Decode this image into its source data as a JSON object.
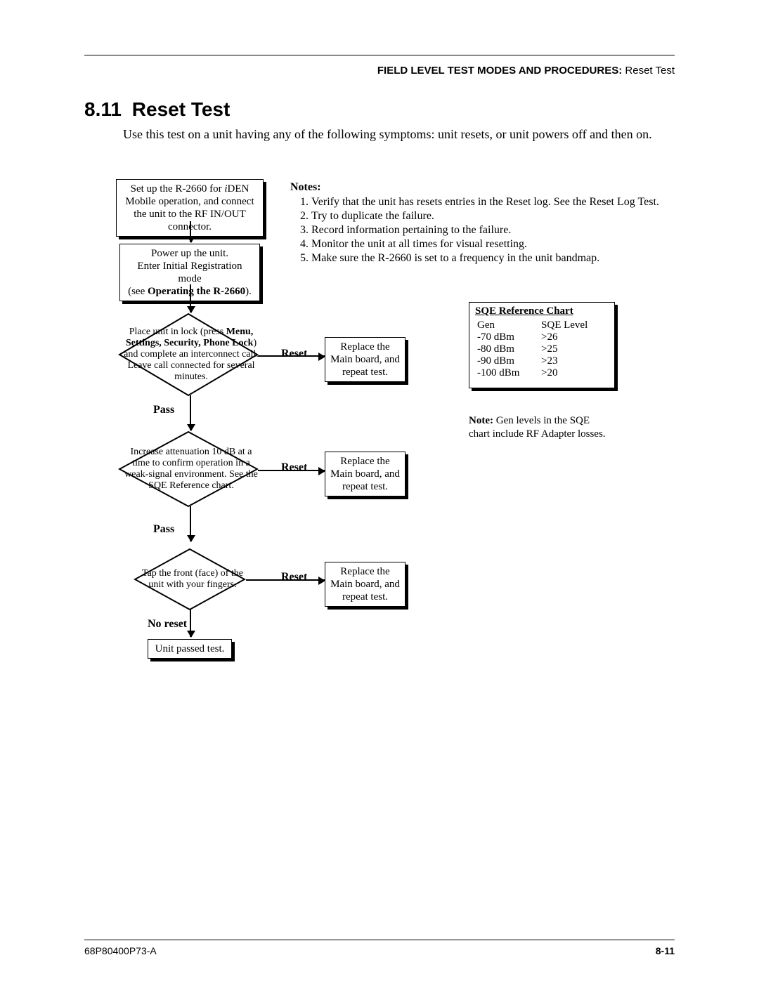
{
  "header": {
    "bold": "FIELD LEVEL TEST MODES AND PROCEDURES:",
    "light": "  Reset Test"
  },
  "section": {
    "number": "8.11",
    "title": "Reset Test"
  },
  "intro": "Use this test on a unit having any of the following symptoms: unit resets, or unit powers off and then on.",
  "flow": {
    "step1_a": "Set up the R-2660 for ",
    "step1_iden": "i",
    "step1_b": "DEN Mobile operation, and connect the unit to the RF IN/OUT connector.",
    "step2_a": "Power up the unit.",
    "step2_b": "Enter Initial Registration mode",
    "step2_c": "(see ",
    "step2_bold": "Operating the R-2660",
    "step2_d": ").",
    "d1_a": "Place unit in lock (press ",
    "d1_bold": "Menu, Settings, Security, Phone Lock",
    "d1_b": ") and complete an interconnect call. Leave call connected for several minutes.",
    "d2": "Increase attenuation 10 dB at a time to confirm operation in a weak-signal environment. See the SQE Reference chart.",
    "d3": "Tap the front (face) of the unit with your fingers.",
    "replace": "Replace the Main board, and repeat test.",
    "reset_label": "Reset",
    "pass_label": "Pass",
    "noreset_label": "No reset",
    "final": "Unit passed test."
  },
  "notes": {
    "heading": "Notes:",
    "items": [
      "Verify that the unit has resets entries in the Reset log. See the Reset Log Test.",
      "Try to duplicate the failure.",
      "Record information pertaining to the failure.",
      "Monitor the unit at all times for visual resetting.",
      "Make sure the R-2660 is set to a frequency in the unit bandmap."
    ]
  },
  "sqe": {
    "title": "SQE Reference Chart",
    "col1": "Gen",
    "col2": "SQE Level",
    "rows": [
      {
        "gen": "-70 dBm",
        "sqe": ">26"
      },
      {
        "gen": "-80 dBm",
        "sqe": ">25"
      },
      {
        "gen": "-90 dBm",
        "sqe": ">23"
      },
      {
        "gen": "-100 dBm",
        "sqe": ">20"
      }
    ],
    "note_bold": "Note:",
    "note": " Gen levels in the SQE chart include RF Adapter losses."
  },
  "footer": {
    "doc": "68P80400P73-A",
    "page": "8-11"
  },
  "chart_data": {
    "type": "table",
    "title": "SQE Reference Chart",
    "columns": [
      "Gen",
      "SQE Level"
    ],
    "rows": [
      [
        "-70 dBm",
        ">26"
      ],
      [
        "-80 dBm",
        ">25"
      ],
      [
        "-90 dBm",
        ">23"
      ],
      [
        "-100 dBm",
        ">20"
      ]
    ]
  }
}
